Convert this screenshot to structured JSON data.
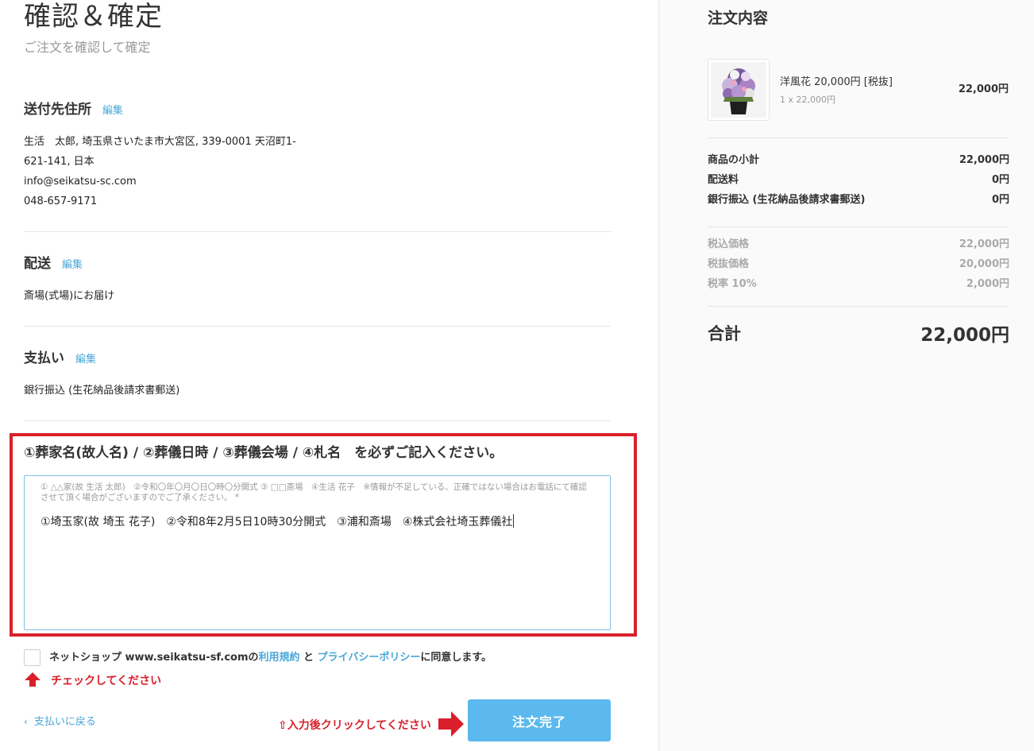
{
  "header": {
    "title": "確認＆確定",
    "subtitle": "ご注文を確認して確定"
  },
  "shipping_address": {
    "heading": "送付先住所",
    "edit_label": "編集",
    "line1": "生活　太郎, 埼玉県さいたま市大宮区, 339-0001 天沼町1-",
    "line2": "621-141, 日本",
    "email": "info@seikatsu-sc.com",
    "phone": "048-657-9171"
  },
  "delivery": {
    "heading": "配送",
    "edit_label": "編集",
    "value": "斎場(式場)にお届け"
  },
  "payment": {
    "heading": "支払い",
    "edit_label": "編集",
    "value": "銀行振込 (生花納品後請求書郵送)"
  },
  "notice": {
    "title": "①葬家名(故人名) / ②葬儀日時 / ③葬儀会場 / ④札名　を必ずご記入ください。",
    "placeholder": "① △△家(故 生活 太郎)　②令和〇年〇月〇日〇時〇分開式 ③ □□斎場　④生活 花子　※情報が不足している、正確ではない場合はお電話にて確認させて頂く場合がございますのでご了承ください。 *",
    "value": "①埼玉家(故 埼玉 花子)　②令和8年2月5日10時30分開式　③浦和斎場　④株式会社埼玉葬儀社"
  },
  "agreement": {
    "prefix": "ネットショップ www.seikatsu-sf.comの",
    "terms_link": "利用規約",
    "and": " と ",
    "privacy_link": "プライバシーポリシー",
    "suffix": "に同意します。",
    "checked": false
  },
  "hints": {
    "check_hint": "チェックしてください",
    "click_hint": "⇧入力後クリックしてください"
  },
  "actions": {
    "back_label": "支払いに戻る",
    "submit_label": "注文完了"
  },
  "summary": {
    "title": "注文内容",
    "item": {
      "name": "洋風花 20,000円 [税抜]",
      "qty": "1 x 22,000円",
      "price": "22,000円"
    },
    "rows": [
      {
        "label": "商品の小計",
        "value": "22,000円"
      },
      {
        "label": "配送料",
        "value": "0円"
      },
      {
        "label": "銀行振込 (生花納品後請求書郵送)",
        "value": "0円"
      }
    ],
    "tax_rows": [
      {
        "label": "税込価格",
        "value": "22,000円"
      },
      {
        "label": "税抜価格",
        "value": "20,000円"
      },
      {
        "label": "税率 10%",
        "value": "2,000円"
      }
    ],
    "total_label": "合計",
    "total_value": "22,000円"
  },
  "colors": {
    "accent": "#4aa8d8",
    "button": "#5cb9ef",
    "alert": "#d9202a"
  }
}
